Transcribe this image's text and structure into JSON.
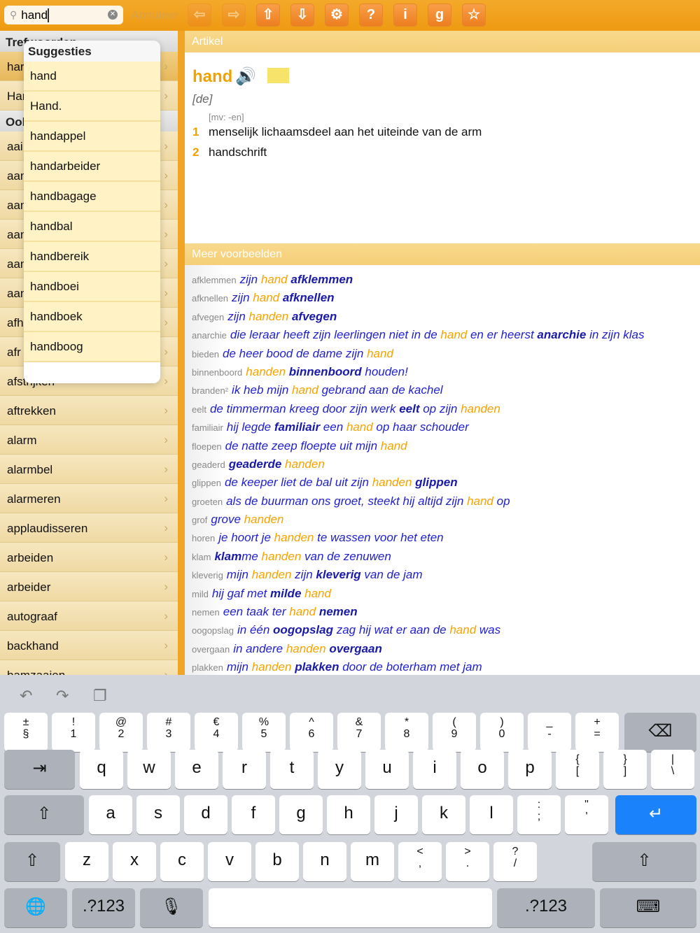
{
  "search": {
    "value": "hand",
    "cancel": "Annuleer"
  },
  "toolbar": [
    {
      "name": "back",
      "g": "⇦",
      "dim": true
    },
    {
      "name": "forward",
      "g": "⇨",
      "dim": true
    },
    {
      "name": "up",
      "g": "⇧"
    },
    {
      "name": "down",
      "g": "⇩"
    },
    {
      "name": "settings",
      "g": "⚙"
    },
    {
      "name": "help",
      "g": "?"
    },
    {
      "name": "info",
      "g": "i"
    },
    {
      "name": "g",
      "g": "g"
    },
    {
      "name": "favorite",
      "g": "☆"
    }
  ],
  "left": {
    "section1": "Trefwoorden",
    "section2": "Ook",
    "hits": [
      "har",
      "Har"
    ],
    "rows": [
      "aai",
      "aan",
      "aan",
      "aan",
      "aan",
      "aan",
      "afh",
      "afr",
      "afstrijken",
      "aftrekken",
      "alarm",
      "alarmbel",
      "alarmeren",
      "applaudisseren",
      "arbeiden",
      "arbeider",
      "autograaf",
      "backhand",
      "bamzaaien"
    ]
  },
  "suggestions": {
    "title": "Suggesties",
    "items": [
      "hand",
      "Hand.",
      "handappel",
      "handarbeider",
      "handbagage",
      "handbal",
      "handbereik",
      "handboei",
      "handboek",
      "handboog"
    ]
  },
  "article": {
    "header": "Artikel",
    "headword": "hand",
    "gender": "[de]",
    "plural": "[mv: -en]",
    "senses": [
      {
        "n": "1",
        "t": "menselijk lichaamsdeel aan het uiteinde van de arm"
      },
      {
        "n": "2",
        "t": "handschrift"
      }
    ]
  },
  "examples": {
    "header": "Meer voorbeelden",
    "items": [
      {
        "k": "afklemmen",
        "s": [
          [
            "n",
            "zijn "
          ],
          [
            "h",
            "hand"
          ],
          [
            "n",
            " "
          ],
          [
            "b",
            "afklemmen"
          ]
        ]
      },
      {
        "k": "afknellen",
        "s": [
          [
            "n",
            "zijn "
          ],
          [
            "h",
            "hand"
          ],
          [
            "n",
            " "
          ],
          [
            "b",
            "afknellen"
          ]
        ]
      },
      {
        "k": "afvegen",
        "s": [
          [
            "n",
            "zijn "
          ],
          [
            "h",
            "handen"
          ],
          [
            "n",
            " "
          ],
          [
            "b",
            "afvegen"
          ]
        ]
      },
      {
        "k": "anarchie",
        "s": [
          [
            "n",
            "die leraar heeft zijn leerlingen niet in de "
          ],
          [
            "h",
            "hand"
          ],
          [
            "n",
            " en er heerst "
          ],
          [
            "b",
            "anarchie"
          ],
          [
            "n",
            " in zijn klas"
          ]
        ]
      },
      {
        "k": "bieden",
        "s": [
          [
            "n",
            "de heer bood de dame zijn "
          ],
          [
            "h",
            "hand"
          ]
        ]
      },
      {
        "k": "binnenboord",
        "s": [
          [
            "h",
            "handen"
          ],
          [
            "n",
            " "
          ],
          [
            "b",
            "binnenboord"
          ],
          [
            "n",
            " houden!"
          ]
        ]
      },
      {
        "k": "branden²",
        "s": [
          [
            "n",
            "ik heb mijn "
          ],
          [
            "h",
            "hand"
          ],
          [
            "n",
            " gebrand aan de kachel"
          ]
        ]
      },
      {
        "k": "eelt",
        "s": [
          [
            "n",
            "de timmerman kreeg door zijn werk "
          ],
          [
            "b",
            "eelt"
          ],
          [
            "n",
            " op zijn "
          ],
          [
            "h",
            "handen"
          ]
        ]
      },
      {
        "k": "familiair",
        "s": [
          [
            "n",
            "hij legde "
          ],
          [
            "b",
            "familiair"
          ],
          [
            "n",
            " een "
          ],
          [
            "h",
            "hand"
          ],
          [
            "n",
            " op haar schouder"
          ]
        ]
      },
      {
        "k": "floepen",
        "s": [
          [
            "n",
            "de natte zeep floepte uit mijn "
          ],
          [
            "h",
            "hand"
          ]
        ]
      },
      {
        "k": "geaderd",
        "s": [
          [
            "b",
            "geaderde"
          ],
          [
            "n",
            " "
          ],
          [
            "h",
            "handen"
          ]
        ]
      },
      {
        "k": "glippen",
        "s": [
          [
            "n",
            "de keeper liet de bal uit zijn "
          ],
          [
            "h",
            "handen"
          ],
          [
            "n",
            " "
          ],
          [
            "b",
            "glippen"
          ]
        ]
      },
      {
        "k": "groeten",
        "s": [
          [
            "n",
            "als de buurman ons groet, steekt hij altijd zijn "
          ],
          [
            "h",
            "hand"
          ],
          [
            "n",
            " op"
          ]
        ]
      },
      {
        "k": "grof",
        "s": [
          [
            "n",
            "grove "
          ],
          [
            "h",
            "handen"
          ]
        ]
      },
      {
        "k": "horen",
        "s": [
          [
            "n",
            "je hoort je "
          ],
          [
            "h",
            "handen"
          ],
          [
            "n",
            " te wassen voor het eten"
          ]
        ]
      },
      {
        "k": "klam",
        "s": [
          [
            "b",
            "klam"
          ],
          [
            "n",
            "me "
          ],
          [
            "h",
            "handen"
          ],
          [
            "n",
            " van de zenuwen"
          ]
        ]
      },
      {
        "k": "kleverig",
        "s": [
          [
            "n",
            "mijn "
          ],
          [
            "h",
            "handen"
          ],
          [
            "n",
            " zijn "
          ],
          [
            "b",
            "kleverig"
          ],
          [
            "n",
            " van de jam"
          ]
        ]
      },
      {
        "k": "mild",
        "s": [
          [
            "n",
            "hij gaf met "
          ],
          [
            "b",
            "milde"
          ],
          [
            "n",
            " "
          ],
          [
            "h",
            "hand"
          ]
        ]
      },
      {
        "k": "nemen",
        "s": [
          [
            "n",
            "een taak ter "
          ],
          [
            "h",
            "hand"
          ],
          [
            "n",
            " "
          ],
          [
            "b",
            "nemen"
          ]
        ]
      },
      {
        "k": "oogopslag",
        "s": [
          [
            "n",
            "in één "
          ],
          [
            "b",
            "oogopslag"
          ],
          [
            "n",
            " zag hij wat er aan de "
          ],
          [
            "h",
            "hand"
          ],
          [
            "n",
            " was"
          ]
        ]
      },
      {
        "k": "overgaan",
        "s": [
          [
            "n",
            "in andere "
          ],
          [
            "h",
            "handen"
          ],
          [
            "n",
            " "
          ],
          [
            "b",
            "overgaan"
          ]
        ]
      },
      {
        "k": "plakken",
        "s": [
          [
            "n",
            "mijn "
          ],
          [
            "h",
            "handen"
          ],
          [
            "n",
            " "
          ],
          [
            "b",
            "plakken"
          ],
          [
            "n",
            " door de boterham met jam"
          ]
        ]
      }
    ]
  },
  "keyboard": {
    "rows": [
      [
        [
          "±",
          "§"
        ],
        [
          "!",
          "1"
        ],
        [
          "@",
          "2"
        ],
        [
          "#",
          "3"
        ],
        [
          "€",
          "4"
        ],
        [
          "%",
          "5"
        ],
        [
          "^",
          "6"
        ],
        [
          "&",
          "7"
        ],
        [
          "*",
          "8"
        ],
        [
          "(",
          "9"
        ],
        [
          ")",
          "0"
        ],
        [
          "_",
          "-"
        ],
        [
          "+",
          "="
        ]
      ],
      [
        "q",
        "w",
        "e",
        "r",
        "t",
        "y",
        "u",
        "i",
        "o",
        "p",
        [
          "{",
          "["
        ],
        [
          "}",
          "]"
        ],
        [
          "|",
          "\\"
        ]
      ],
      [
        "a",
        "s",
        "d",
        "f",
        "g",
        "h",
        "j",
        "k",
        "l",
        [
          ":",
          ";"
        ],
        [
          "\"",
          "'"
        ]
      ],
      [
        "z",
        "x",
        "c",
        "v",
        "b",
        "n",
        "m",
        [
          "<",
          ","
        ],
        [
          ">",
          "."
        ],
        [
          "?",
          "/"
        ]
      ]
    ],
    "num_label": ".?123",
    "tab": "⇥",
    "backspace": "⌫",
    "shift": "⇧",
    "return": "↵",
    "globe": "🌐",
    "mic": "🎙",
    "hide": "⌨"
  }
}
